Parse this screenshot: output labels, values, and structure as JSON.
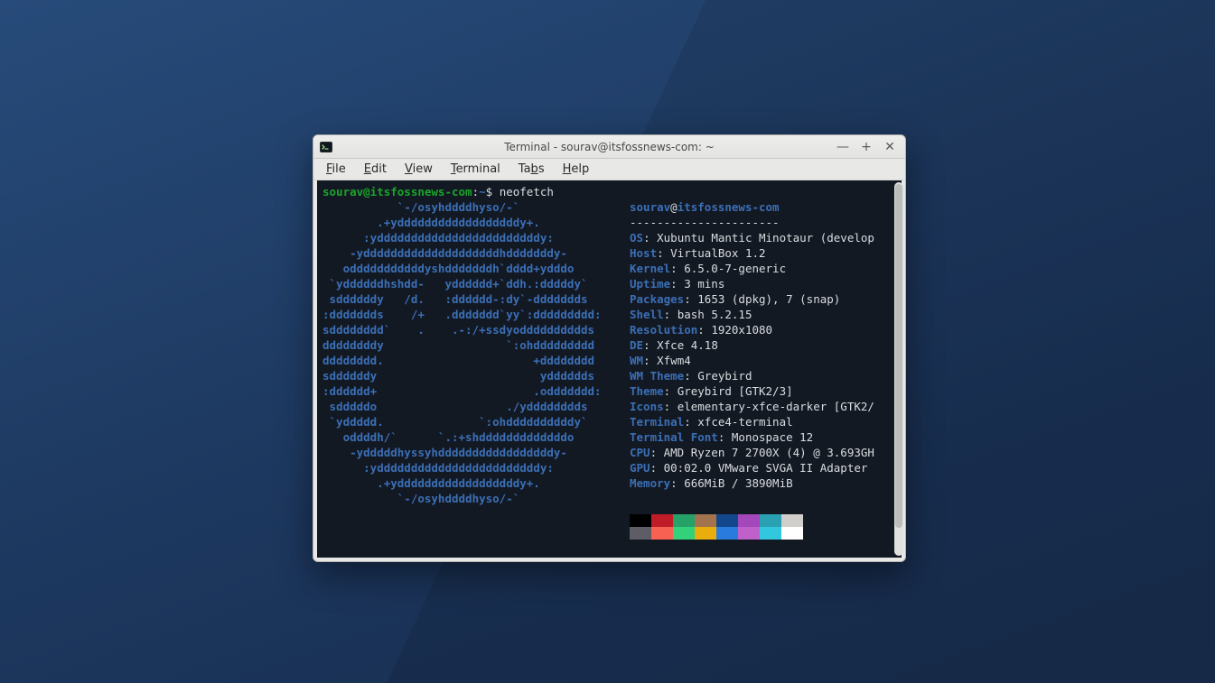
{
  "window": {
    "title": "Terminal - sourav@itsfossnews-com: ~"
  },
  "menu": {
    "file": "File",
    "edit": "Edit",
    "view": "View",
    "terminal": "Terminal",
    "tabs": "Tabs",
    "help": "Help"
  },
  "prompt": {
    "userhost": "sourav@itsfossnews-com",
    "path": "~",
    "sep1": ":",
    "sep2": "$ ",
    "command": "neofetch"
  },
  "header": {
    "user": "sourav",
    "at": "@",
    "host": "itsfossnews-com",
    "dashes": "----------------------"
  },
  "info": {
    "OS": "Xubuntu Mantic Minotaur (develop",
    "Host": "VirtualBox 1.2",
    "Kernel": "6.5.0-7-generic",
    "Uptime": "3 mins",
    "Packages": "1653 (dpkg), 7 (snap)",
    "Shell": "bash 5.2.15",
    "Resolution": "1920x1080",
    "DE": "Xfce 4.18",
    "WM": "Xfwm4",
    "WM Theme": "Greybird",
    "Theme": "Greybird [GTK2/3]",
    "Icons": "elementary-xfce-darker [GTK2/",
    "Terminal": "xfce4-terminal",
    "Terminal Font": "Monospace 12",
    "CPU": "AMD Ryzen 7 2700X (4) @ 3.693GH",
    "GPU": "00:02.0 VMware SVGA II Adapter",
    "Memory": "666MiB / 3890MiB"
  },
  "ascii": [
    "           `-/osyhddddhyso/-`",
    "        .+yddddddddddddddddddy+.",
    "      :yddddddddddddddddddddddddy:",
    "    -yddddddddddddddddddddhdddddddy-",
    "   odddddddddddyshdddddddh`dddd+ydddo",
    " `yddddddhshdd-   ydddddd+`ddh.:dddddy`",
    " sddddddy   /d.   :dddddd-:dy`-ddddddds",
    ":ddddddds    /+   .ddddddd`yy`:ddddddddd:",
    "sdddddddd`    .    .-:/+ssdyodddddddddds",
    "ddddddddy                  `:ohddddddddd",
    "dddddddd.                      +dddddddd",
    "sddddddy                        ydddddds",
    ":dddddd+                       .oddddddd:",
    " sdddddo                   ./ydddddddds",
    " `yddddd.              `:ohddddddddddy`",
    "   oddddh/`      `.:+shdddddddddddddo",
    "    -ydddddhyssyhdddddddddddddddddy-",
    "      :yddddddddddddddddddddddddy:",
    "        .+yddddddddddddddddddy+.",
    "           `-/osyhddddhyso/-`"
  ],
  "palette": {
    "row1": [
      "#000000",
      "#c01c28",
      "#26a269",
      "#a2734c",
      "#12488b",
      "#a347ba",
      "#2aa1b3",
      "#d0cfcc"
    ],
    "row2": [
      "#5e5c64",
      "#f66151",
      "#33d17a",
      "#e9ad0c",
      "#2a7bde",
      "#c061cb",
      "#33c7de",
      "#ffffff"
    ]
  }
}
